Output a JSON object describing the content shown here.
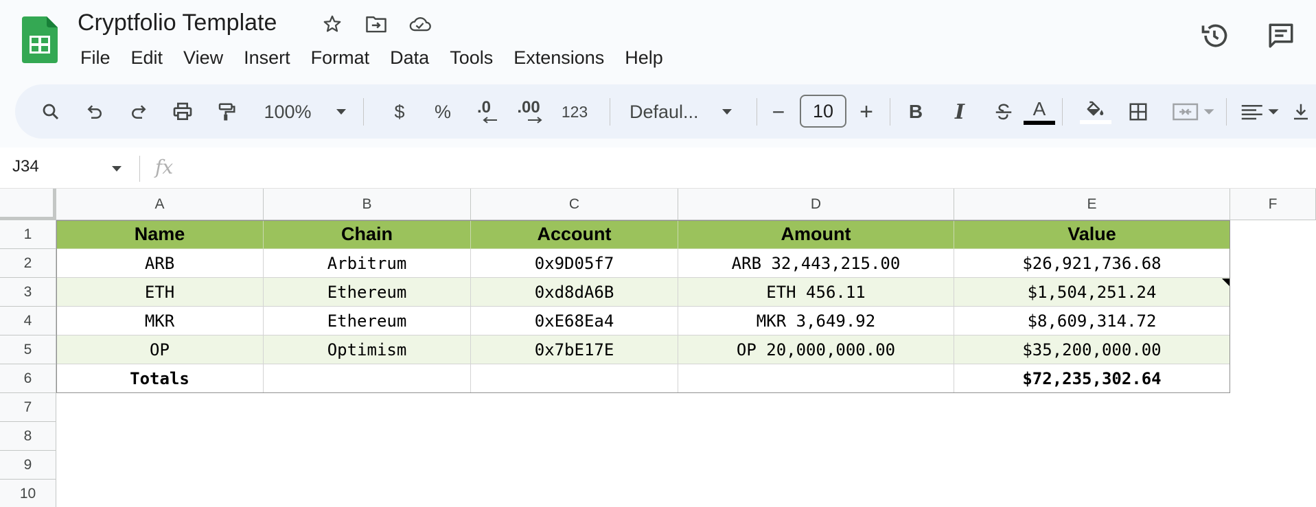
{
  "app": {
    "title": "Cryptfolio Template",
    "menu": [
      "File",
      "Edit",
      "View",
      "Insert",
      "Format",
      "Data",
      "Tools",
      "Extensions",
      "Help"
    ]
  },
  "toolbar": {
    "zoom": "100%",
    "currency": "$",
    "percent": "%",
    "decrease_decimal": ".0",
    "increase_decimal": ".00",
    "number_format": "123",
    "font": "Defaul...",
    "font_size": "10",
    "minus": "−",
    "plus": "+",
    "bold": "B",
    "italic": "I",
    "text_color_letter": "A"
  },
  "formula_bar": {
    "cell_ref": "J34",
    "fx": "fx"
  },
  "sheet": {
    "columns": [
      "A",
      "B",
      "C",
      "D",
      "E",
      "F"
    ],
    "rows": [
      "1",
      "2",
      "3",
      "4",
      "5",
      "6",
      "7",
      "8",
      "9",
      "10"
    ],
    "header": [
      "Name",
      "Chain",
      "Account",
      "Amount",
      "Value"
    ],
    "data": [
      [
        "ARB",
        "Arbitrum",
        "0x9D05f7",
        "ARB 32,443,215.00",
        "$26,921,736.68"
      ],
      [
        "ETH",
        "Ethereum",
        "0xd8dA6B",
        "ETH 456.11",
        "$1,504,251.24"
      ],
      [
        "MKR",
        "Ethereum",
        "0xE68Ea4",
        "MKR 3,649.92",
        "$8,609,314.72"
      ],
      [
        "OP",
        "Optimism",
        "0x7bE17E",
        "OP 20,000,000.00",
        "$35,200,000.00"
      ]
    ],
    "totals": [
      "Totals",
      "",
      "",
      "",
      "$72,235,302.64"
    ]
  },
  "colors": {
    "header_fill": "#9bc25c",
    "alt_row_fill": "#eff6e5",
    "logo_green": "#34a853"
  }
}
